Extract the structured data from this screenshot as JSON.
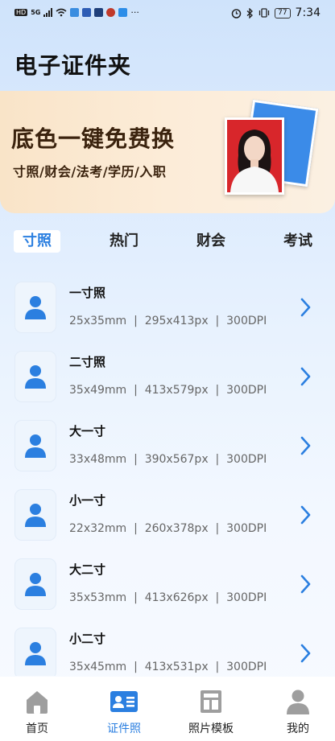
{
  "status_bar": {
    "left_badges": [
      "HD",
      "5G"
    ],
    "more": "···",
    "battery": "77",
    "time": "7:34"
  },
  "header": {
    "title": "电子证件夹"
  },
  "banner": {
    "title": "底色一键免费换",
    "subtitle": "寸照/财会/法考/学历/入职"
  },
  "tabs": [
    {
      "label": "寸照",
      "active": true
    },
    {
      "label": "热门",
      "active": false
    },
    {
      "label": "财会",
      "active": false
    },
    {
      "label": "考试",
      "active": false
    }
  ],
  "items": [
    {
      "name": "一寸照",
      "spec": "25x35mm  |  295x413px  |  300DPI"
    },
    {
      "name": "二寸照",
      "spec": "35x49mm  |  413x579px  |  300DPI"
    },
    {
      "name": "大一寸",
      "spec": "33x48mm  |  390x567px  |  300DPI"
    },
    {
      "name": "小一寸",
      "spec": "22x32mm  |  260x378px  |  300DPI"
    },
    {
      "name": "大二寸",
      "spec": "35x53mm  |  413x626px  |  300DPI"
    },
    {
      "name": "小二寸",
      "spec": "35x45mm  |  413x531px  |  300DPI"
    }
  ],
  "bottom_nav": [
    {
      "label": "首页",
      "icon": "home-icon",
      "active": false
    },
    {
      "label": "证件照",
      "icon": "id-card-icon",
      "active": true
    },
    {
      "label": "照片模板",
      "icon": "template-icon",
      "active": false
    },
    {
      "label": "我的",
      "icon": "user-icon",
      "active": false
    }
  ],
  "colors": {
    "accent": "#2b7fe0",
    "banner_text": "#3b230e",
    "photo_red": "#d8262b",
    "photo_blue": "#3b8be8"
  }
}
